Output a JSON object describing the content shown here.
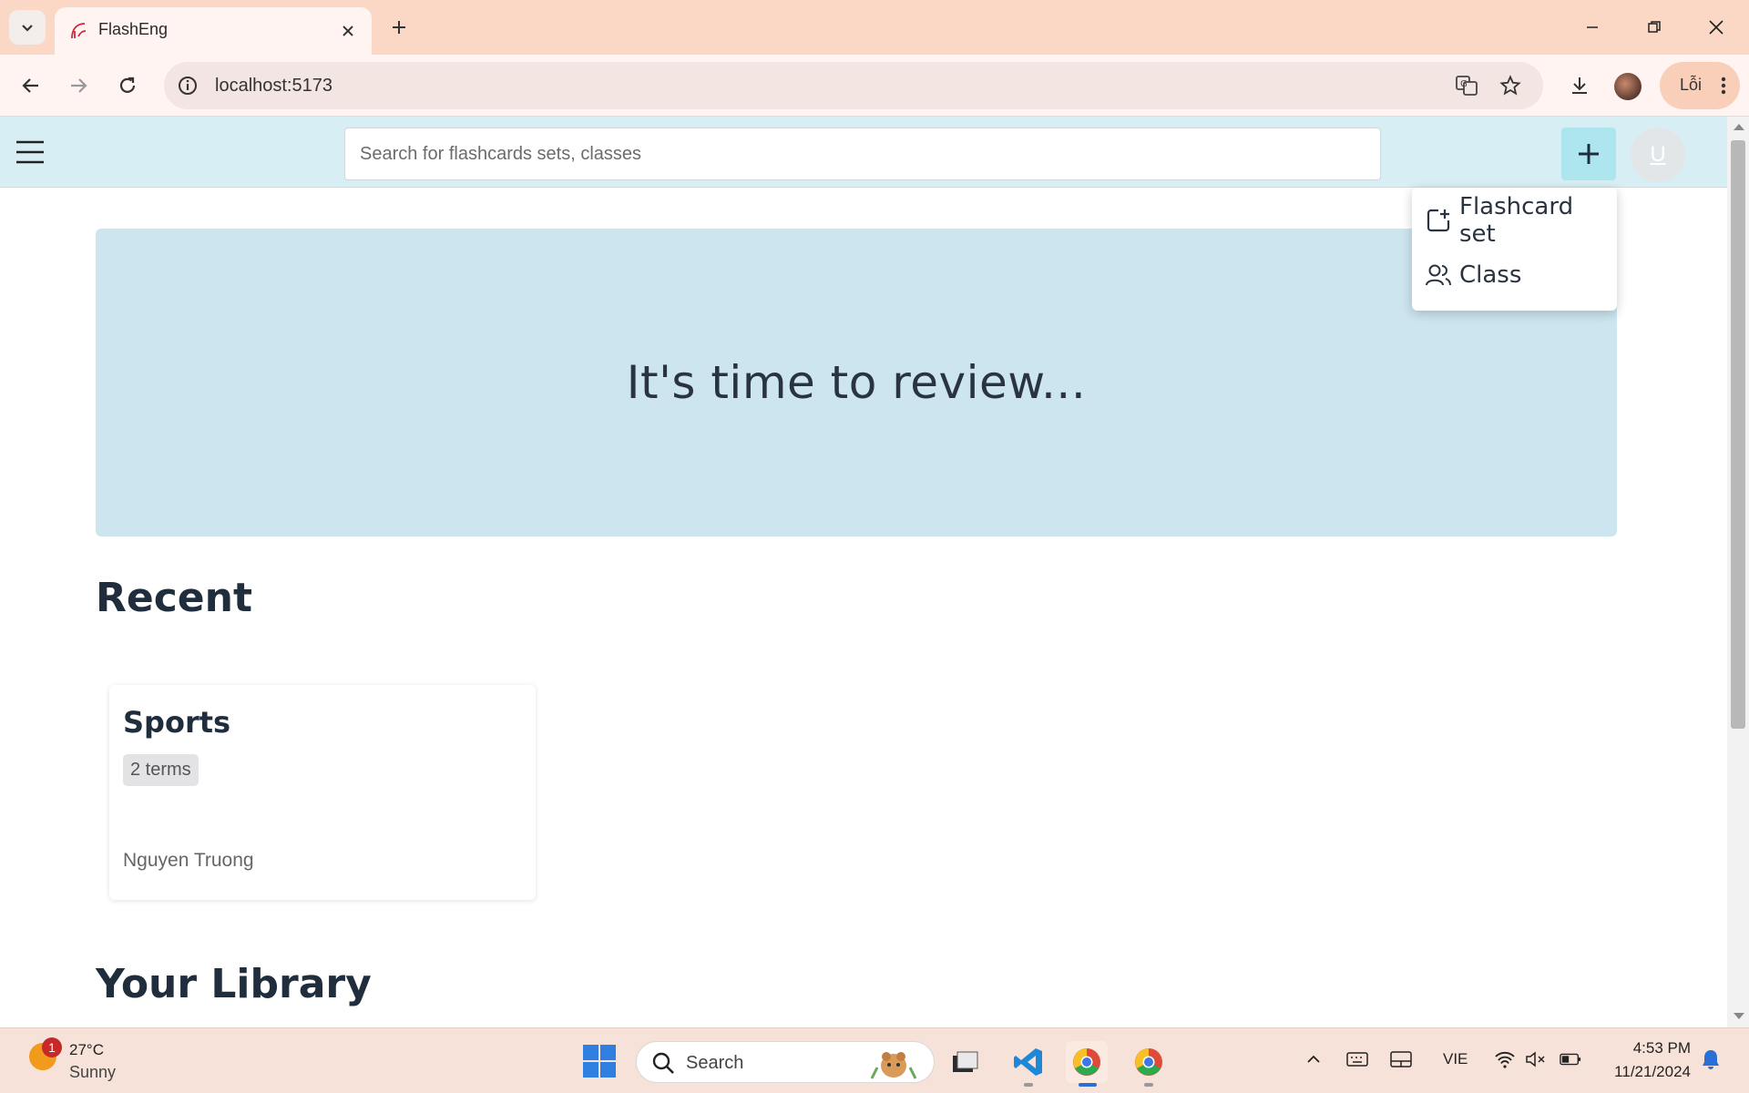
{
  "browser": {
    "tab_title": "FlashEng",
    "url": "localhost:5173",
    "profile_label": "Lỗi"
  },
  "app": {
    "search_placeholder": "Search for flashcards sets, classes",
    "user_initial": "U",
    "hero_text": "It's time to review...",
    "recent_title": "Recent",
    "library_title": "Your Library",
    "recent_cards": [
      {
        "title": "Sports",
        "terms": "2 terms",
        "author": "Nguyen Truong"
      }
    ],
    "create_menu": [
      {
        "label": "Flashcard set",
        "icon": "flashcard-add-icon"
      },
      {
        "label": "Class",
        "icon": "users-icon"
      }
    ]
  },
  "taskbar": {
    "weather_temp": "27°C",
    "weather_desc": "Sunny",
    "weather_badge": "1",
    "search_label": "Search",
    "language": "VIE",
    "time": "4:53 PM",
    "date": "11/21/2024"
  },
  "colors": {
    "tabbar": "#fbd8c6",
    "app_header": "#d7eff4",
    "hero": "#cce5ef",
    "add_button": "#aee6ef",
    "heading_text": "#1f2d3d"
  }
}
